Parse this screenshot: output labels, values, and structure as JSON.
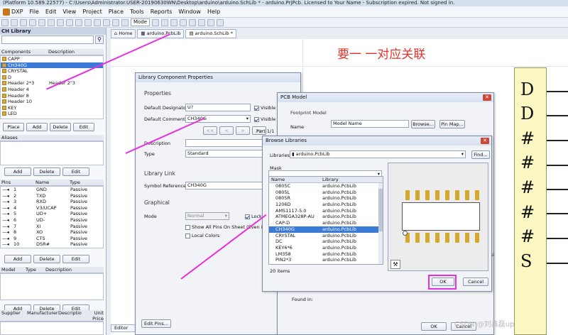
{
  "window": {
    "title": "(Platform 10.589.22577) - C:\\Users\\Administrator.USER-20190630WN\\Desktop\\arduino\\arduino.SchLib * - arduino.PrjPcb. Licensed to Your Name - Subscription expired. Not signed in."
  },
  "menu": {
    "dxp": "DXP",
    "items": [
      "File",
      "Edit",
      "View",
      "Project",
      "Place",
      "Tools",
      "Reports",
      "Window",
      "Help"
    ]
  },
  "toolbar": {
    "mode_label": "Mode"
  },
  "panel": {
    "title": "CH Library",
    "components_header": [
      "Components",
      "Description"
    ],
    "components": [
      {
        "name": "CAPP",
        "desc": ""
      },
      {
        "name": "CH340G",
        "desc": ""
      },
      {
        "name": "CRYSTAL",
        "desc": ""
      },
      {
        "name": "D",
        "desc": ""
      },
      {
        "name": "Header 2*3",
        "desc": "Header 2\"3"
      },
      {
        "name": "Header 4",
        "desc": ""
      },
      {
        "name": "Header 8",
        "desc": ""
      },
      {
        "name": "Header 10",
        "desc": ""
      },
      {
        "name": "KEY",
        "desc": ""
      },
      {
        "name": "LED",
        "desc": ""
      }
    ],
    "buttons1": [
      "Place",
      "Add",
      "Delete",
      "Edit"
    ],
    "aliases_label": "Aliases",
    "buttons2": [
      "Add",
      "Delete",
      "Edit"
    ],
    "pins_header": [
      "Pins",
      "Name",
      "Type"
    ],
    "pins": [
      {
        "n": "1",
        "name": "GND",
        "type": "Passive"
      },
      {
        "n": "2",
        "name": "TXD",
        "type": "Passive"
      },
      {
        "n": "3",
        "name": "RXD",
        "type": "Passive"
      },
      {
        "n": "4",
        "name": "V3/UCAP",
        "type": "Passive"
      },
      {
        "n": "5",
        "name": "UD+",
        "type": "Passive"
      },
      {
        "n": "6",
        "name": "UD-",
        "type": "Passive"
      },
      {
        "n": "7",
        "name": "XI",
        "type": "Passive"
      },
      {
        "n": "8",
        "name": "XO",
        "type": "Passive"
      },
      {
        "n": "9",
        "name": "CTS",
        "type": "Passive"
      },
      {
        "n": "10",
        "name": "DSR#",
        "type": "Passive"
      }
    ],
    "buttons3": [
      "Add",
      "Delete",
      "Edit"
    ],
    "model_header": [
      "Model",
      "Type",
      "Description"
    ],
    "buttons4": [
      "Add",
      "Delete",
      "Edit"
    ],
    "supplier_header": [
      "Supplier",
      "Manufacturer",
      "Descriptio",
      "Unit Price"
    ]
  },
  "tabs": [
    "Home",
    "arduino.PcbLib",
    "arduino.SchLib *"
  ],
  "editor_tab": "Editor",
  "annotation": "要一 一对应关联",
  "pin_chars": [
    "D",
    "D",
    "#",
    "#",
    "#",
    "#",
    "#",
    "S"
  ],
  "lcp": {
    "title": "Library Component Properties",
    "properties": "Properties",
    "designator_label": "Default Designator",
    "designator": "U?",
    "comment_label": "Default Comment",
    "comment": "CH340G",
    "visible": "Visible",
    "part": "Part 1/1",
    "description_label": "Description",
    "type_label": "Type",
    "type": "Standard",
    "library_link": "Library Link",
    "symbol_ref_label": "Symbol Reference",
    "symbol_ref": "CH340G",
    "graphical": "Graphical",
    "mode_label": "Mode",
    "mode": "Normal",
    "lock": "Lock",
    "show_all_pins": "Show All Pins On Sheet (Even if Hidd",
    "local_colors": "Local Colors",
    "edit_pins": "Edit Pins...",
    "nav": [
      "<<",
      "<",
      ">",
      ">>"
    ]
  },
  "pcb": {
    "title": "PCB Model",
    "footprint_model": "Footprint Model",
    "name_label": "Name",
    "name": "Model Name",
    "browse": "Browse...",
    "pinmap": "Pin Map...",
    "found_in": "Found in:",
    "ok": "OK",
    "cancel": "Cancel",
    "partial": "osi"
  },
  "browse": {
    "title": "Browse Libraries",
    "libraries_label": "Libraries",
    "library": "arduino.PcbLib",
    "find": "Find...",
    "mask_label": "Mask",
    "col_name": "Name",
    "col_library": "Library",
    "rows": [
      {
        "name": "0805C",
        "lib": "arduino.PcbLib"
      },
      {
        "name": "0805L",
        "lib": "arduino.PcbLib"
      },
      {
        "name": "0805R",
        "lib": "arduino.PcbLib"
      },
      {
        "name": "1206D",
        "lib": "arduino.PcbLib"
      },
      {
        "name": "AMS1117-5.0",
        "lib": "arduino.PcbLib"
      },
      {
        "name": "ATMEGA328P-AU",
        "lib": "arduino.PcbLib"
      },
      {
        "name": "CAP-D",
        "lib": "arduino.PcbLib"
      },
      {
        "name": "CH340G",
        "lib": "arduino.PcbLib"
      },
      {
        "name": "CRYSTAL",
        "lib": "arduino.PcbLib"
      },
      {
        "name": "DC",
        "lib": "arduino.PcbLib"
      },
      {
        "name": "KEY6*6",
        "lib": "arduino.PcbLib"
      },
      {
        "name": "LM358",
        "lib": "arduino.PcbLib"
      },
      {
        "name": "PIN2*3",
        "lib": "arduino.PcbLib"
      }
    ],
    "count": "20 items",
    "ok": "OK",
    "cancel": "Cancel"
  },
  "watermark": "CSDN @刘鑫磊up",
  "colors": {
    "selection": "#3b7bd6",
    "annotation_red": "#e8302a",
    "highlight_magenta": "#e82fe0"
  }
}
